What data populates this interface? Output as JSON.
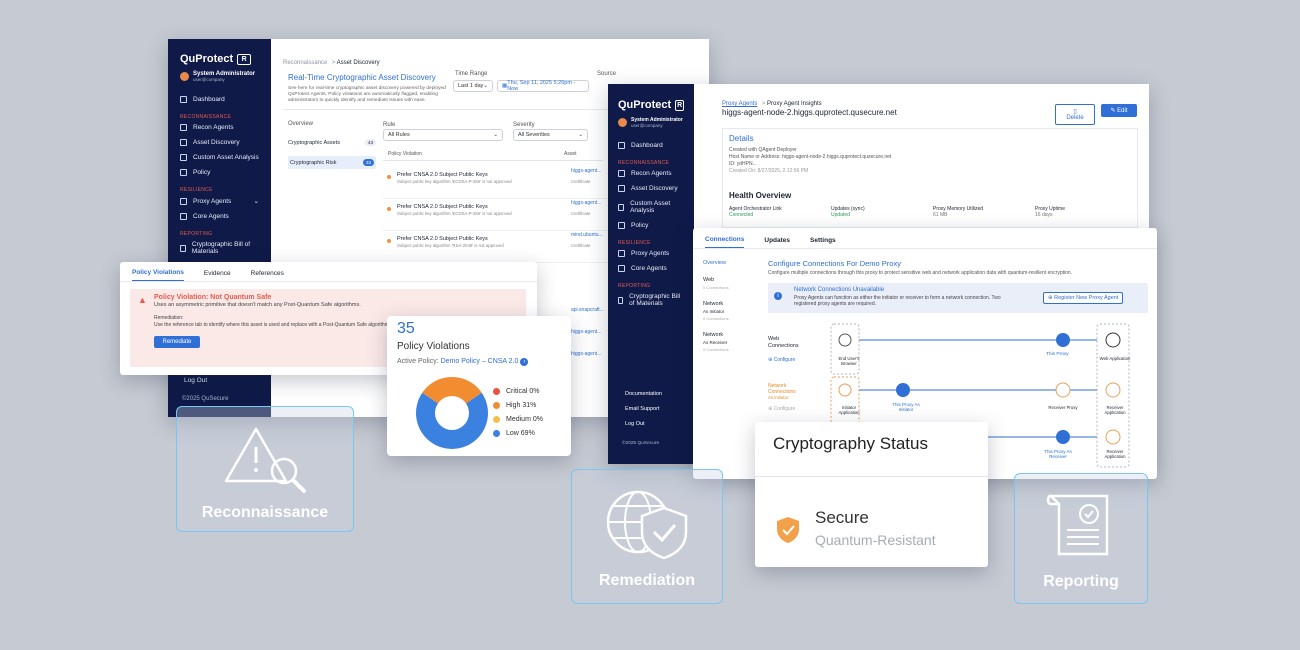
{
  "colors": {
    "navy": "#0f1a48",
    "accent": "#2f6fd6",
    "orange": "#f29340",
    "red": "#e85a4f",
    "tile_border": "#79c7ee"
  },
  "screen1": {
    "logo": "QuProtect",
    "logo_mark": "R",
    "user_name": "System Administrator",
    "user_email": "user@company",
    "nav": {
      "dashboard": "Dashboard",
      "sec_recon": "RECONNAISSANCE",
      "recon_agents": "Recon Agents",
      "asset_discovery": "Asset Discovery",
      "custom_asset": "Custom Asset Analysis",
      "policy": "Policy",
      "sec_resilience": "RESILIENCE",
      "proxy_agents": "Proxy Agents",
      "core_agents": "Core Agents",
      "sec_reporting": "REPORTING",
      "cbom": "Cryptographic Bill of Materials",
      "logout": "Log Out",
      "copyright": "©2025 QuSecure"
    },
    "breadcrumb_1": "Reconnaissance",
    "breadcrumb_2": "Asset Discovery",
    "title": "Real-Time Cryptographic Asset Discovery",
    "description": "See here for real-time cryptographic asset discovery powered by deployed QuProtect Agents. Policy violations are automatically flagged, enabling administrators to quickly identify and remediate issues with ease.",
    "time_range_label": "Time Range",
    "time_range_value": "Last 1 day",
    "date_value": "Thu, Sep 11, 2025 5:26pm - Now",
    "source_label": "Source",
    "overview": "Overview",
    "side_tab_1": "Cryptographic Assets",
    "side_tab_1_count": "43",
    "side_tab_2": "Cryptographic Risk",
    "side_tab_2_count": "33",
    "rule_label": "Rule",
    "rule_value": "All Rules",
    "severity_label": "Severity",
    "severity_value": "All Severities",
    "col_violation": "Policy Violation",
    "col_asset": "Asset",
    "rows": [
      {
        "title": "Prefer CNSA 2.0 Subject Public Keys",
        "sub": "Subject public key algorithm 'ECDSA-P-256' is not approved",
        "asset": "higgs-agent...",
        "asset_type": "Certificate"
      },
      {
        "title": "Prefer CNSA 2.0 Subject Public Keys",
        "sub": "Subject public key algorithm 'ECDSA-P-256' is not approved",
        "asset": "higgs-agent...",
        "asset_type": "Certificate"
      },
      {
        "title": "Prefer CNSA 2.0 Subject Public Keys",
        "sub": "Subject public key algorithm 'RSA-2048' is not approved",
        "asset": "mind.ubuntu...",
        "asset_type": "Certificate"
      }
    ],
    "extra_assets": [
      "api.snapcraft...",
      "higgs-agent...",
      "higgs-agent..."
    ]
  },
  "violation_panel": {
    "tab_1": "Policy Violations",
    "tab_2": "Evidence",
    "tab_3": "References",
    "alert_title": "Policy Violation: Not Quantum Safe",
    "alert_sub": "Uses an asymmetric primitive that doesn't match any Post-Quantum Safe algorithms.",
    "remediation_label": "Remediation:",
    "remediation_text": "Use the reference tab to identify where this asset is used and replace with a Post-Quantum Safe algorithm.",
    "button": "Remediate"
  },
  "donut_card": {
    "count": "35",
    "title": "Policy Violations",
    "policy_prefix": "Active Policy:",
    "policy_name": "Demo Policy – CNSA 2.0",
    "legend": [
      {
        "label": "Critical 0%",
        "color": "#e8503f",
        "value": 0
      },
      {
        "label": "High 31%",
        "color": "#f28c30",
        "value": 31
      },
      {
        "label": "Medium 0%",
        "color": "#f2c14e",
        "value": 0
      },
      {
        "label": "Low 69%",
        "color": "#3b82e0",
        "value": 69
      }
    ]
  },
  "screen2": {
    "breadcrumb_1": "Proxy Agents",
    "breadcrumb_2": "Proxy Agent Insights",
    "host": "higgs-agent-node-2.higgs.quprotect.qusecure.net",
    "delete": "Delete",
    "edit": "Edit",
    "details": "Details",
    "created_with": "Created with QAgent Deployer",
    "hostname_line": "Host Name or Address: higgs-agent-node-2.higgs.quprotect.qusecure.net",
    "id_line": "ID: ydHPN...",
    "created_on": "Created On: 8/27/2025, 2:12:56 PM",
    "health": "Health Overview",
    "h1_label": "Agent Orchestrator Link",
    "h1_value": "Connected",
    "h2_label": "Updates (sync)",
    "h2_value": "Updated",
    "h3_label": "Proxy Memory Utilized",
    "h3_value": "61 MB",
    "h4_label": "Proxy Uptime",
    "h4_value": "16 days",
    "nav": {
      "dashboard": "Dashboard",
      "sec_recon": "RECONNAISSANCE",
      "recon_agents": "Recon Agents",
      "asset_discovery": "Asset Discovery",
      "custom_asset": "Custom Asset Analysis",
      "policy": "Policy",
      "sec_resilience": "RESILIENCE",
      "proxy_agents": "Proxy Agents",
      "core_agents": "Core Agents",
      "sec_reporting": "REPORTING",
      "cbom": "Cryptographic Bill of Materials",
      "documentation": "Documentation",
      "email": "Email Support",
      "logout": "Log Out",
      "copyright": "©2025 QuSecure"
    }
  },
  "connections_panel": {
    "tab_1": "Connections",
    "tab_2": "Updates",
    "tab_3": "Settings",
    "side_overview": "Overview",
    "side_web": "Web",
    "side_web_sub": "0 Connections",
    "side_initiator": "Network",
    "side_initiator_sub": "As Initiator",
    "side_initiator_count": "0 Connections",
    "side_receiver": "Network",
    "side_receiver_sub": "As Receiver",
    "side_receiver_count": "0 Connections",
    "title": "Configure Connections For Demo Proxy",
    "subtitle": "Configure multiple connections through this proxy to protect sensitive web and network application data with quantum-resilient encryption.",
    "alert_title": "Network Connections Unavailable",
    "alert_body": "Proxy Agents can function as either the initiator or receiver to form a network connection. Two registered proxy agents are required.",
    "register_btn": "Register New Proxy Agent",
    "web_conn": "Web Connections",
    "configure": "Configure",
    "net_init": "Network Connections",
    "net_init_sub": "As Initiator",
    "end_user": "End User's Browser",
    "this_proxy": "This Proxy",
    "web_app": "Web Application",
    "initiator_app": "Initiator Application",
    "this_proxy_init": "This Proxy As Initiator",
    "receiver_proxy": "Receiver Proxy",
    "receiver_app": "Receiver Application",
    "this_proxy_recv": "This Proxy As Receiver"
  },
  "crypto_status": {
    "title": "Cryptography Status",
    "status": "Secure",
    "status_sub": "Quantum-Resistant"
  },
  "tiles": {
    "reconnaissance": "Reconnaissance",
    "remediation": "Remediation",
    "reporting": "Reporting"
  }
}
